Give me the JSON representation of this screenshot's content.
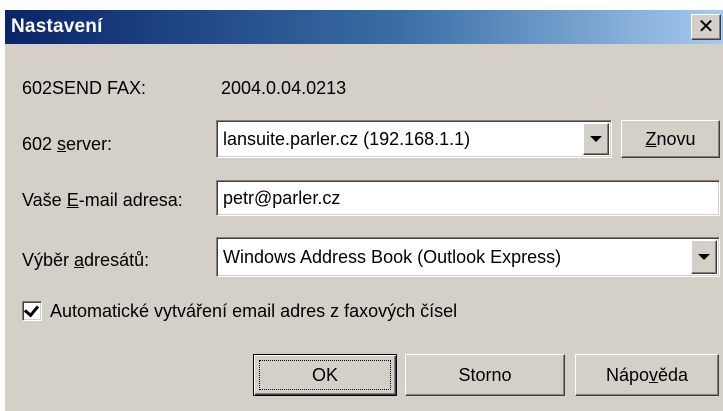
{
  "window": {
    "title": "Nastavení",
    "close_label": "✕"
  },
  "fax": {
    "label": "602SEND FAX:",
    "version": "2004.0.04.0213"
  },
  "server": {
    "label_pre": "602 ",
    "label_key": "s",
    "label_post": "erver:",
    "selected": "lansuite.parler.cz (192.168.1.1)",
    "refresh_pre": "",
    "refresh_key": "Z",
    "refresh_post": "novu"
  },
  "email": {
    "label_pre": "Vaše ",
    "label_key": "E",
    "label_post": "-mail adresa:",
    "value": "petr@parler.cz"
  },
  "recipients": {
    "label_pre": "Výběr ",
    "label_key": "a",
    "label_post": "dresátů:",
    "selected": "Windows Address Book (Outlook Express)"
  },
  "auto_email": {
    "checked": true,
    "label": "Automatické vytváření email adres z faxových čísel"
  },
  "buttons": {
    "ok_label": "OK",
    "cancel_label": "Storno",
    "help_pre": "Nápo",
    "help_key": "v",
    "help_post": "ěda"
  }
}
